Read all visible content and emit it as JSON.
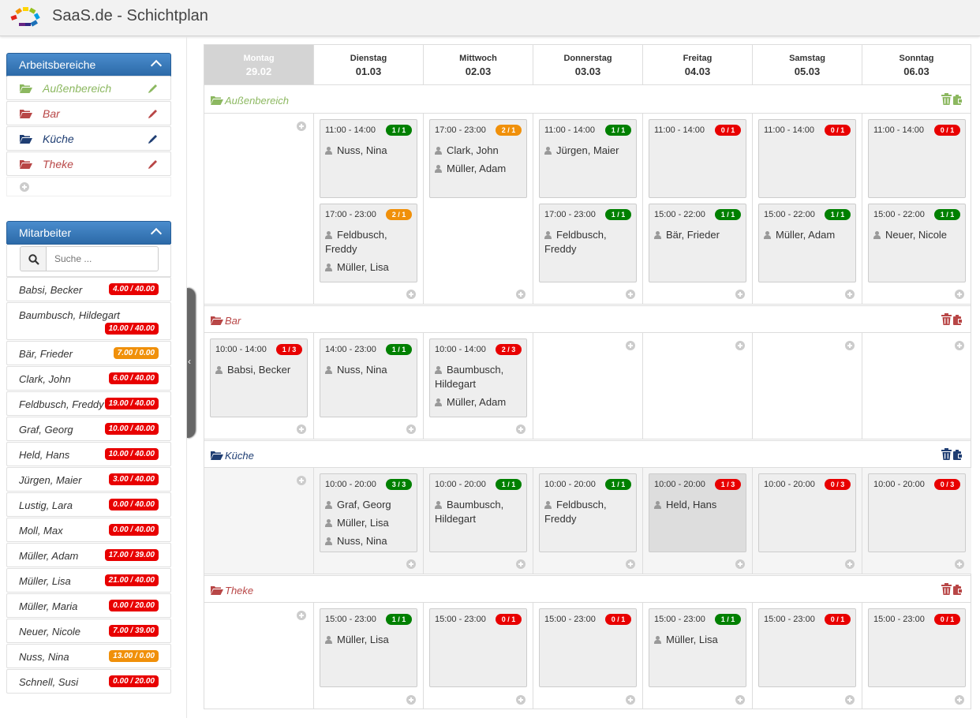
{
  "app": {
    "title": "SaaS.de - Schichtplan"
  },
  "colors": {
    "green": "#008000",
    "orange": "#f0900a",
    "red": "#e80000",
    "area_green": "#8cb860",
    "area_red": "#b84646",
    "area_blue": "#1f3e73"
  },
  "sidebar": {
    "areas_title": "Arbeitsbereiche",
    "areas": [
      {
        "label": "Außenbereich",
        "color": "#8cb860"
      },
      {
        "label": "Bar",
        "color": "#b84646"
      },
      {
        "label": "Küche",
        "color": "#1f3e73"
      },
      {
        "label": "Theke",
        "color": "#b84646"
      }
    ],
    "employees_title": "Mitarbeiter",
    "search_placeholder": "Suche ...",
    "employees": [
      {
        "name": "Babsi, Becker",
        "hours": "4.00 / 40.00",
        "status": "red"
      },
      {
        "name": "Baumbusch, Hildegart",
        "hours": "10.00 / 40.00",
        "status": "red"
      },
      {
        "name": "Bär, Frieder",
        "hours": "7.00 / 0.00",
        "status": "orange"
      },
      {
        "name": "Clark, John",
        "hours": "6.00 / 40.00",
        "status": "red"
      },
      {
        "name": "Feldbusch, Freddy",
        "hours": "19.00 / 40.00",
        "status": "red"
      },
      {
        "name": "Graf, Georg",
        "hours": "10.00 / 40.00",
        "status": "red"
      },
      {
        "name": "Held, Hans",
        "hours": "10.00 / 40.00",
        "status": "red"
      },
      {
        "name": "Jürgen, Maier",
        "hours": "3.00 / 40.00",
        "status": "red"
      },
      {
        "name": "Lustig, Lara",
        "hours": "0.00 / 40.00",
        "status": "red"
      },
      {
        "name": "Moll, Max",
        "hours": "0.00 / 40.00",
        "status": "red"
      },
      {
        "name": "Müller, Adam",
        "hours": "17.00 / 39.00",
        "status": "red"
      },
      {
        "name": "Müller, Lisa",
        "hours": "21.00 / 40.00",
        "status": "red"
      },
      {
        "name": "Müller, Maria",
        "hours": "0.00 / 20.00",
        "status": "red"
      },
      {
        "name": "Neuer, Nicole",
        "hours": "7.00 / 39.00",
        "status": "red"
      },
      {
        "name": "Nuss, Nina",
        "hours": "13.00 / 0.00",
        "status": "orange"
      },
      {
        "name": "Schnell, Susi",
        "hours": "0.00 / 20.00",
        "status": "red"
      }
    ]
  },
  "days": [
    {
      "name": "Montag",
      "date": "29.02",
      "active": true
    },
    {
      "name": "Dienstag",
      "date": "01.03"
    },
    {
      "name": "Mittwoch",
      "date": "02.03"
    },
    {
      "name": "Donnerstag",
      "date": "03.03"
    },
    {
      "name": "Freitag",
      "date": "04.03"
    },
    {
      "name": "Samstag",
      "date": "05.03"
    },
    {
      "name": "Sonntag",
      "date": "06.03"
    }
  ],
  "areas": [
    {
      "name": "Außenbereich",
      "color": "#8cb860",
      "grey_row": false,
      "shifts": [
        [],
        [
          {
            "time": "11:00 - 14:00",
            "badge": "1 / 1",
            "status": "green",
            "people": [
              "Nuss, Nina"
            ]
          },
          {
            "time": "17:00 - 23:00",
            "badge": "2 / 1",
            "status": "orange",
            "people": [
              "Feldbusch, Freddy",
              "Müller, Lisa"
            ]
          }
        ],
        [
          {
            "time": "17:00 - 23:00",
            "badge": "2 / 1",
            "status": "orange",
            "people": [
              "Clark, John",
              "Müller, Adam"
            ]
          }
        ],
        [
          {
            "time": "11:00 - 14:00",
            "badge": "1 / 1",
            "status": "green",
            "people": [
              "Jürgen, Maier"
            ]
          },
          {
            "time": "17:00 - 23:00",
            "badge": "1 / 1",
            "status": "green",
            "people": [
              "Feldbusch, Freddy"
            ]
          }
        ],
        [
          {
            "time": "11:00 - 14:00",
            "badge": "0 / 1",
            "status": "red",
            "people": []
          },
          {
            "time": "15:00 - 22:00",
            "badge": "1 / 1",
            "status": "green",
            "people": [
              "Bär, Frieder"
            ]
          }
        ],
        [
          {
            "time": "11:00 - 14:00",
            "badge": "0 / 1",
            "status": "red",
            "people": []
          },
          {
            "time": "15:00 - 22:00",
            "badge": "1 / 1",
            "status": "green",
            "people": [
              "Müller, Adam"
            ]
          }
        ],
        [
          {
            "time": "11:00 - 14:00",
            "badge": "0 / 1",
            "status": "red",
            "people": []
          },
          {
            "time": "15:00 - 22:00",
            "badge": "1 / 1",
            "status": "green",
            "people": [
              "Neuer, Nicole"
            ]
          }
        ]
      ]
    },
    {
      "name": "Bar",
      "color": "#b84646",
      "grey_row": false,
      "shifts": [
        [
          {
            "time": "10:00 - 14:00",
            "badge": "1 / 3",
            "status": "red",
            "people": [
              "Babsi, Becker"
            ]
          }
        ],
        [
          {
            "time": "14:00 - 23:00",
            "badge": "1 / 1",
            "status": "green",
            "people": [
              "Nuss, Nina"
            ]
          }
        ],
        [
          {
            "time": "10:00 - 14:00",
            "badge": "2 / 3",
            "status": "red",
            "people": [
              "Baumbusch, Hildegart",
              "Müller, Adam"
            ]
          }
        ],
        [],
        [],
        [],
        []
      ]
    },
    {
      "name": "Küche",
      "color": "#1f3e73",
      "grey_row": true,
      "shifts": [
        [],
        [
          {
            "time": "10:00 - 20:00",
            "badge": "3 / 3",
            "status": "green",
            "people": [
              "Graf, Georg",
              "Müller, Lisa",
              "Nuss, Nina"
            ]
          }
        ],
        [
          {
            "time": "10:00 - 20:00",
            "badge": "1 / 1",
            "status": "green",
            "people": [
              "Baumbusch, Hildegart"
            ]
          }
        ],
        [
          {
            "time": "10:00 - 20:00",
            "badge": "1 / 1",
            "status": "green",
            "people": [
              "Feldbusch, Freddy"
            ]
          }
        ],
        [
          {
            "time": "10:00 - 20:00",
            "badge": "1 / 3",
            "status": "red",
            "people": [
              "Held, Hans"
            ],
            "dark": true
          }
        ],
        [
          {
            "time": "10:00 - 20:00",
            "badge": "0 / 3",
            "status": "red",
            "people": []
          }
        ],
        [
          {
            "time": "10:00 - 20:00",
            "badge": "0 / 3",
            "status": "red",
            "people": []
          }
        ]
      ]
    },
    {
      "name": "Theke",
      "color": "#b84646",
      "grey_row": false,
      "shifts": [
        [],
        [
          {
            "time": "15:00 - 23:00",
            "badge": "1 / 1",
            "status": "green",
            "people": [
              "Müller, Lisa"
            ]
          }
        ],
        [
          {
            "time": "15:00 - 23:00",
            "badge": "0 / 1",
            "status": "red",
            "people": []
          }
        ],
        [
          {
            "time": "15:00 - 23:00",
            "badge": "0 / 1",
            "status": "red",
            "people": []
          }
        ],
        [
          {
            "time": "15:00 - 23:00",
            "badge": "1 / 1",
            "status": "green",
            "people": [
              "Müller, Lisa"
            ]
          }
        ],
        [
          {
            "time": "15:00 - 23:00",
            "badge": "0 / 1",
            "status": "red",
            "people": []
          }
        ],
        [
          {
            "time": "15:00 - 23:00",
            "badge": "0 / 1",
            "status": "red",
            "people": []
          }
        ]
      ]
    }
  ]
}
